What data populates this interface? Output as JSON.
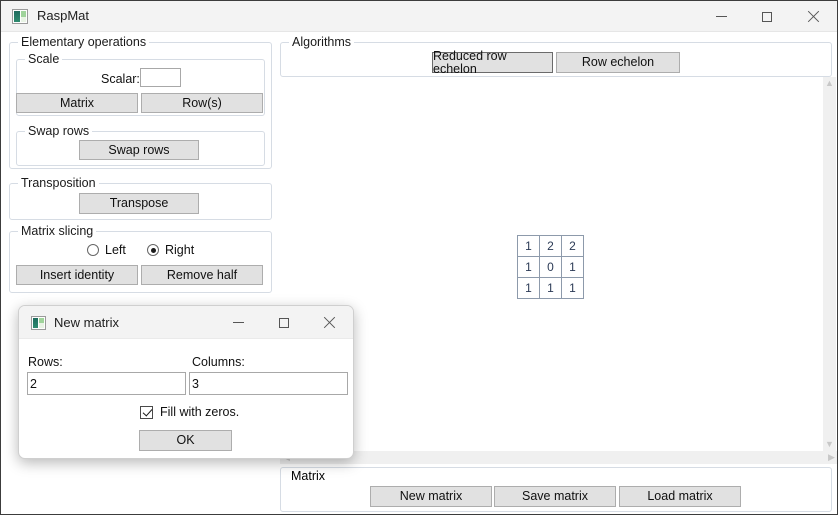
{
  "window": {
    "title": "RaspMat",
    "icon": "app-icon",
    "controls": {
      "minimize": "minimize-icon",
      "maximize": "maximize-icon",
      "close": "close-icon"
    }
  },
  "left_panel": {
    "elementary_operations": {
      "title": "Elementary operations",
      "scale": {
        "title": "Scale",
        "scalar_label": "Scalar:",
        "scalar_value": "",
        "matrix_button": "Matrix",
        "rows_button": "Row(s)"
      },
      "swap": {
        "title": "Swap rows",
        "swap_button": "Swap rows"
      }
    },
    "transposition": {
      "title": "Transposition",
      "transpose_button": "Transpose"
    },
    "matrix_slicing": {
      "title": "Matrix slicing",
      "radio_left": "Left",
      "radio_right": "Right",
      "selected_side": "Right",
      "insert_identity_button": "Insert identity",
      "remove_half_button": "Remove half"
    }
  },
  "algorithms": {
    "title": "Algorithms",
    "reduced_row_echelon_button": "Reduced row echelon",
    "row_echelon_button": "Row echelon"
  },
  "canvas": {
    "matrix": {
      "rows": 3,
      "cols": 3,
      "cells": [
        [
          "1",
          "2",
          "2"
        ],
        [
          "1",
          "0",
          "1"
        ],
        [
          "1",
          "1",
          "1"
        ]
      ]
    },
    "scrollbars": {
      "vertical_up": "scroll-up-icon",
      "vertical_down": "scroll-down-icon",
      "horizontal_left": "scroll-left-icon",
      "horizontal_right": "scroll-right-icon"
    }
  },
  "bottom_bar": {
    "title": "Matrix",
    "new_matrix_button": "New matrix",
    "save_matrix_button": "Save matrix",
    "load_matrix_button": "Load matrix"
  },
  "dialog": {
    "title": "New matrix",
    "icon": "app-icon",
    "controls": {
      "minimize": "minimize-icon",
      "maximize": "maximize-icon",
      "close": "close-icon"
    },
    "rows_label": "Rows:",
    "rows_value": "2",
    "columns_label": "Columns:",
    "columns_value": "3",
    "fill_zeros_label": "Fill with zeros.",
    "fill_zeros_checked": true,
    "ok_button": "OK"
  }
}
